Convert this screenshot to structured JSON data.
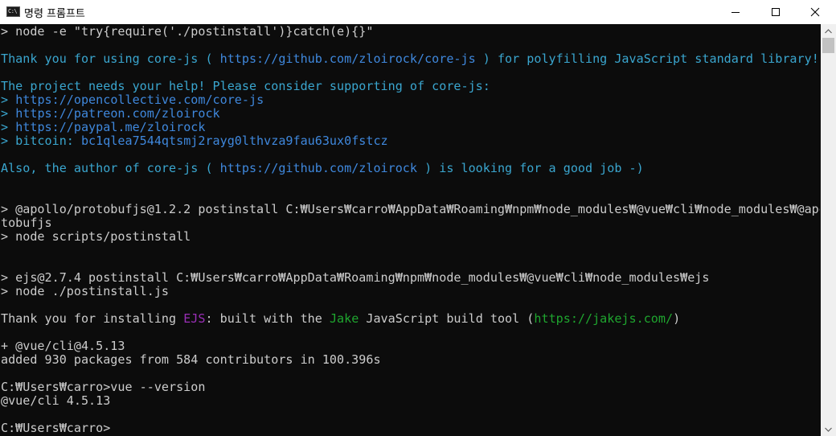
{
  "window": {
    "title": "명령 프롬프트",
    "icon_label": "C:\\",
    "icons": {
      "minimize": "minimize-icon",
      "maximize": "maximize-icon",
      "close": "close-icon"
    }
  },
  "colors": {
    "background": "#0c0c0c",
    "default_text": "#cccccc",
    "cyan": "#3aa6cf",
    "link": "#3f88dd",
    "magenta": "#9a2fb6",
    "green": "#1fa62f"
  },
  "terminal": {
    "lines": [
      [
        {
          "text": "> node -e \"try{require('./postinstall')}catch(e){}\"",
          "color": "default"
        }
      ],
      [],
      [
        {
          "text": "Thank you for using core-js ( ",
          "color": "cyan"
        },
        {
          "text": "https://github.com/zloirock/core-js",
          "color": "link"
        },
        {
          "text": " ) for polyfilling JavaScript standard library!",
          "color": "cyan"
        }
      ],
      [],
      [
        {
          "text": "The project needs your help! Please consider supporting of core-js:",
          "color": "cyan"
        }
      ],
      [
        {
          "text": "> ",
          "color": "cyan"
        },
        {
          "text": "https://opencollective.com/core-js",
          "color": "link"
        }
      ],
      [
        {
          "text": "> ",
          "color": "cyan"
        },
        {
          "text": "https://patreon.com/zloirock",
          "color": "link"
        }
      ],
      [
        {
          "text": "> ",
          "color": "cyan"
        },
        {
          "text": "https://paypal.me/zloirock",
          "color": "link"
        }
      ],
      [
        {
          "text": "> bitcoin: ",
          "color": "cyan"
        },
        {
          "text": "bc1qlea7544qtsmj2rayg0lthvza9fau63ux0fstcz",
          "color": "link"
        }
      ],
      [],
      [
        {
          "text": "Also, the author of core-js ( ",
          "color": "cyan"
        },
        {
          "text": "https://github.com/zloirock",
          "color": "link"
        },
        {
          "text": " ) is looking for a good job -)",
          "color": "cyan"
        }
      ],
      [],
      [],
      [
        {
          "text": "> @apollo/protobufjs@1.2.2 postinstall C:₩Users₩carro₩AppData₩Roaming₩npm₩node_modules₩@vue₩cli₩node_modules₩@apollo₩pro",
          "color": "default"
        }
      ],
      [
        {
          "text": "tobufjs",
          "color": "default"
        }
      ],
      [
        {
          "text": "> node scripts/postinstall",
          "color": "default"
        }
      ],
      [],
      [],
      [
        {
          "text": "> ejs@2.7.4 postinstall C:₩Users₩carro₩AppData₩Roaming₩npm₩node_modules₩@vue₩cli₩node_modules₩ejs",
          "color": "default"
        }
      ],
      [
        {
          "text": "> node ./postinstall.js",
          "color": "default"
        }
      ],
      [],
      [
        {
          "text": "Thank you for installing ",
          "color": "default"
        },
        {
          "text": "EJS",
          "color": "magenta"
        },
        {
          "text": ": built with the ",
          "color": "default"
        },
        {
          "text": "Jake",
          "color": "green"
        },
        {
          "text": " JavaScript build tool (",
          "color": "default"
        },
        {
          "text": "https://jakejs.com/",
          "color": "green"
        },
        {
          "text": ")",
          "color": "default"
        }
      ],
      [],
      [
        {
          "text": "+ @vue/cli@4.5.13",
          "color": "default"
        }
      ],
      [
        {
          "text": "added 930 packages from 584 contributors in 100.396s",
          "color": "default"
        }
      ],
      [],
      [
        {
          "text": "C:₩Users₩carro>vue --version",
          "color": "default"
        }
      ],
      [
        {
          "text": "@vue/cli 4.5.13",
          "color": "default"
        }
      ],
      [],
      [
        {
          "text": "C:₩Users₩carro>",
          "color": "default"
        }
      ]
    ]
  },
  "scrollbar": {
    "position": 0.0
  }
}
